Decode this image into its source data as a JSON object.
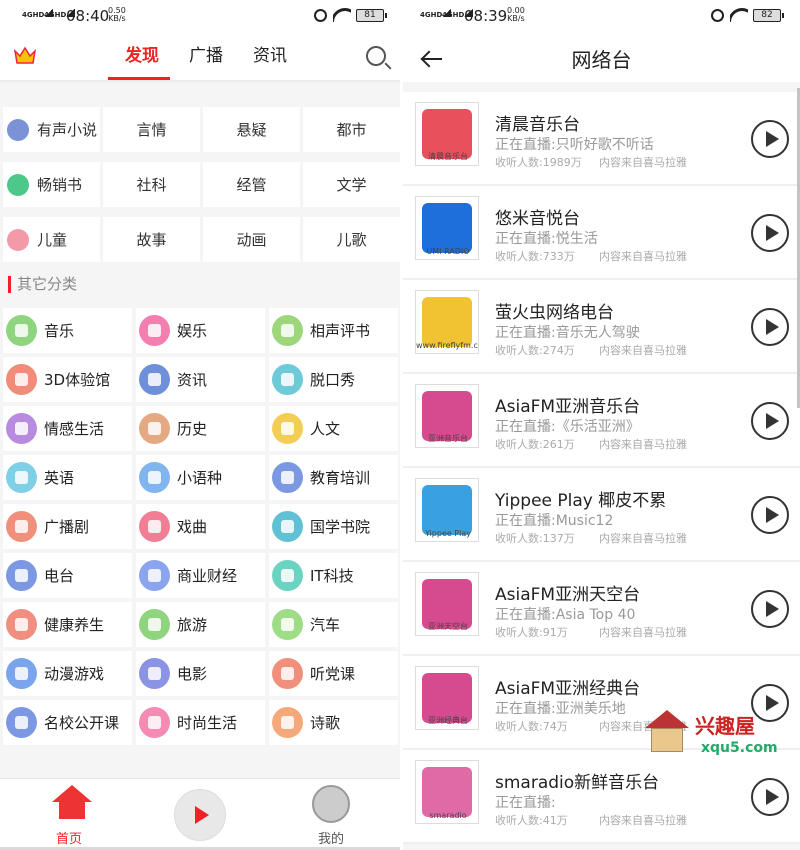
{
  "left": {
    "status": {
      "signal": "4GHD",
      "time": "08:40",
      "speed": "0.50",
      "speed_unit": "KB/s",
      "battery": "81"
    },
    "tabs": [
      "发现",
      "广播",
      "资讯"
    ],
    "categories": [
      {
        "label": "有声小说",
        "icon": "book-icon",
        "color": "#7b93d6"
      },
      {
        "label": "言情"
      },
      {
        "label": "悬疑"
      },
      {
        "label": "都市"
      },
      {
        "label": "畅销书",
        "icon": "ebook-icon",
        "color": "#4cc98a"
      },
      {
        "label": "社科"
      },
      {
        "label": "经管"
      },
      {
        "label": "文学"
      },
      {
        "label": "儿童",
        "icon": "pig-icon",
        "color": "#f39aa8"
      },
      {
        "label": "故事"
      },
      {
        "label": "动画"
      },
      {
        "label": "儿歌"
      }
    ],
    "other_title": "其它分类",
    "others": [
      {
        "label": "音乐",
        "icon": "music-note-icon",
        "color": "#8fd47e"
      },
      {
        "label": "娱乐",
        "icon": "smiley-icon",
        "color": "#f57eb0"
      },
      {
        "label": "相声评书",
        "icon": "fan-icon",
        "color": "#9ed67c"
      },
      {
        "label": "3D体验馆",
        "icon": "cube-icon",
        "color": "#f28c7a"
      },
      {
        "label": "资讯",
        "icon": "news-icon",
        "color": "#6f8fd9"
      },
      {
        "label": "脱口秀",
        "icon": "microphone-icon",
        "color": "#6ec9d9"
      },
      {
        "label": "情感生活",
        "icon": "heart-icon",
        "color": "#b88ae0"
      },
      {
        "label": "历史",
        "icon": "building-icon",
        "color": "#e4a883"
      },
      {
        "label": "人文",
        "icon": "brush-icon",
        "color": "#f4cd57"
      },
      {
        "label": "英语",
        "icon": "letter-a-icon",
        "color": "#7fd0e6"
      },
      {
        "label": "小语种",
        "icon": "planet-icon",
        "color": "#80b5ef"
      },
      {
        "label": "教育培训",
        "icon": "calendar-icon",
        "color": "#7c98e3"
      },
      {
        "label": "广播剧",
        "icon": "radio-icon",
        "color": "#f0907c"
      },
      {
        "label": "戏曲",
        "icon": "opera-icon",
        "color": "#f07f95"
      },
      {
        "label": "国学书院",
        "icon": "graduation-cap-icon",
        "color": "#61c1d4"
      },
      {
        "label": "电台",
        "icon": "medal-icon",
        "color": "#7c98e3"
      },
      {
        "label": "商业财经",
        "icon": "chart-icon",
        "color": "#8aa4ee"
      },
      {
        "label": "IT科技",
        "icon": "gear-icon",
        "color": "#6bd3c2"
      },
      {
        "label": "健康养生",
        "icon": "cup-icon",
        "color": "#f08f7f"
      },
      {
        "label": "旅游",
        "icon": "plane-icon",
        "color": "#8fd47e"
      },
      {
        "label": "汽车",
        "icon": "car-icon",
        "color": "#9fdc86"
      },
      {
        "label": "动漫游戏",
        "icon": "gamepad-icon",
        "color": "#7aa5ec"
      },
      {
        "label": "电影",
        "icon": "film-icon",
        "color": "#8b93e4"
      },
      {
        "label": "听党课",
        "icon": "hammer-sickle-icon",
        "color": "#f0907c"
      },
      {
        "label": "名校公开课",
        "icon": "clipboard-icon",
        "color": "#7c98e3"
      },
      {
        "label": "时尚生活",
        "icon": "high-heel-icon",
        "color": "#f58ab4"
      },
      {
        "label": "诗歌",
        "icon": "leaf-icon",
        "color": "#f5a97a"
      }
    ],
    "nav": {
      "home": "首页",
      "mine": "我的"
    }
  },
  "right": {
    "status": {
      "signal": "4GHD",
      "time": "08:39",
      "speed": "0.00",
      "speed_unit": "KB/s",
      "battery": "82"
    },
    "title": "网络台",
    "items": [
      {
        "name": "清晨音乐台",
        "live": "正在直播:只听好歌不听话",
        "listeners": "收听人数:1989万",
        "source": "内容来自喜马拉雅",
        "logo_text": "清晨音乐台",
        "logo_color": "#e8505b"
      },
      {
        "name": "悠米音悦台",
        "live": "正在直播:悦生活",
        "listeners": "收听人数:733万",
        "source": "内容来自喜马拉雅",
        "logo_text": "UMI RADIO",
        "logo_color": "#1e6fd9"
      },
      {
        "name": "萤火虫网络电台",
        "live": "正在直播:音乐无人驾驶",
        "listeners": "收听人数:274万",
        "source": "内容来自喜马拉雅",
        "logo_text": "www.fireflyfm.com",
        "logo_color": "#f1c232"
      },
      {
        "name": "AsiaFM亚洲音乐台",
        "live": "正在直播:《乐活亚洲》",
        "listeners": "收听人数:261万",
        "source": "内容来自喜马拉雅",
        "logo_text": "亚洲音乐台",
        "logo_color": "#d64b8f"
      },
      {
        "name": "Yippee Play 椰皮不累",
        "live": "正在直播:Music12",
        "listeners": "收听人数:137万",
        "source": "内容来自喜马拉雅",
        "logo_text": "Yippee Play",
        "logo_color": "#3aa1e0"
      },
      {
        "name": "AsiaFM亚洲天空台",
        "live": "正在直播:Asia Top 40",
        "listeners": "收听人数:91万",
        "source": "内容来自喜马拉雅",
        "logo_text": "亚洲天空台",
        "logo_color": "#d64b8f"
      },
      {
        "name": "AsiaFM亚洲经典台",
        "live": "正在直播:亚洲美乐地",
        "listeners": "收听人数:74万",
        "source": "内容来自喜马拉雅",
        "logo_text": "亚洲经典台",
        "logo_color": "#d64b8f"
      },
      {
        "name": "smaradio新鲜音乐台",
        "live": "正在直播:",
        "listeners": "收听人数:41万",
        "source": "内容来自喜马拉雅",
        "logo_text": "smaradio",
        "logo_color": "#e06aa5"
      }
    ]
  },
  "watermark": {
    "title": "兴趣屋",
    "url": "xqu5.com"
  }
}
